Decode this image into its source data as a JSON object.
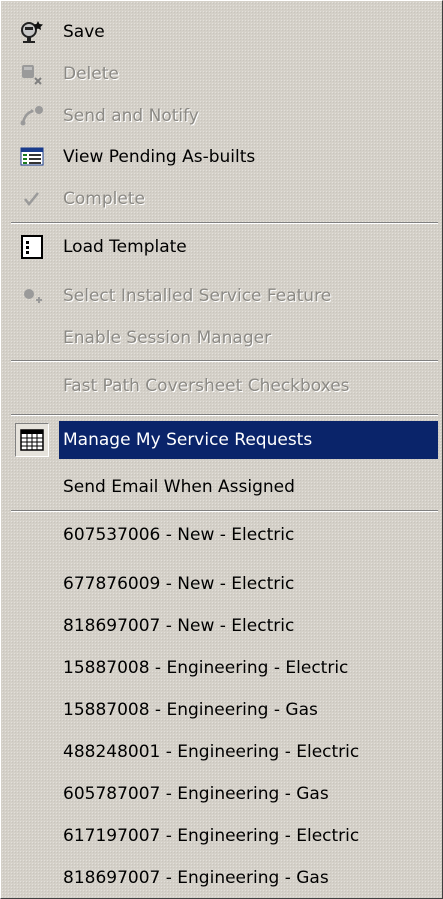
{
  "menu": {
    "items": [
      {
        "label": "Save",
        "icon": "save-icon"
      },
      {
        "label": "Delete",
        "icon": "delete-icon"
      },
      {
        "label": "Send and Notify",
        "icon": "send-notify-icon"
      },
      {
        "label": "View Pending As-builts",
        "icon": "view-pending-icon"
      },
      {
        "label": "Complete",
        "icon": "checkmark-icon"
      },
      {
        "label": "Load Template",
        "icon": "template-icon"
      },
      {
        "label": "Select Installed Service Feature",
        "icon": "select-feature-icon"
      },
      {
        "label": "Enable Session Manager"
      },
      {
        "label": "Fast Path Coversheet Checkboxes"
      },
      {
        "label": "Manage My Service Requests",
        "icon": "grid-table-icon"
      },
      {
        "label": "Send Email When Assigned"
      }
    ],
    "service_requests": [
      "607537006 - New - Electric",
      "677876009 - New - Electric",
      "818697007 - New - Electric",
      "15887008 - Engineering - Electric",
      "15887008 - Engineering - Gas",
      "488248001 - Engineering - Electric",
      "605787007 - Engineering - Gas",
      "617197007 - Engineering - Electric",
      "818697007 - Engineering - Gas"
    ],
    "colors": {
      "background": "#d4d0c8",
      "highlight": "#0a246a",
      "disabled_text": "#8c8a85"
    }
  }
}
